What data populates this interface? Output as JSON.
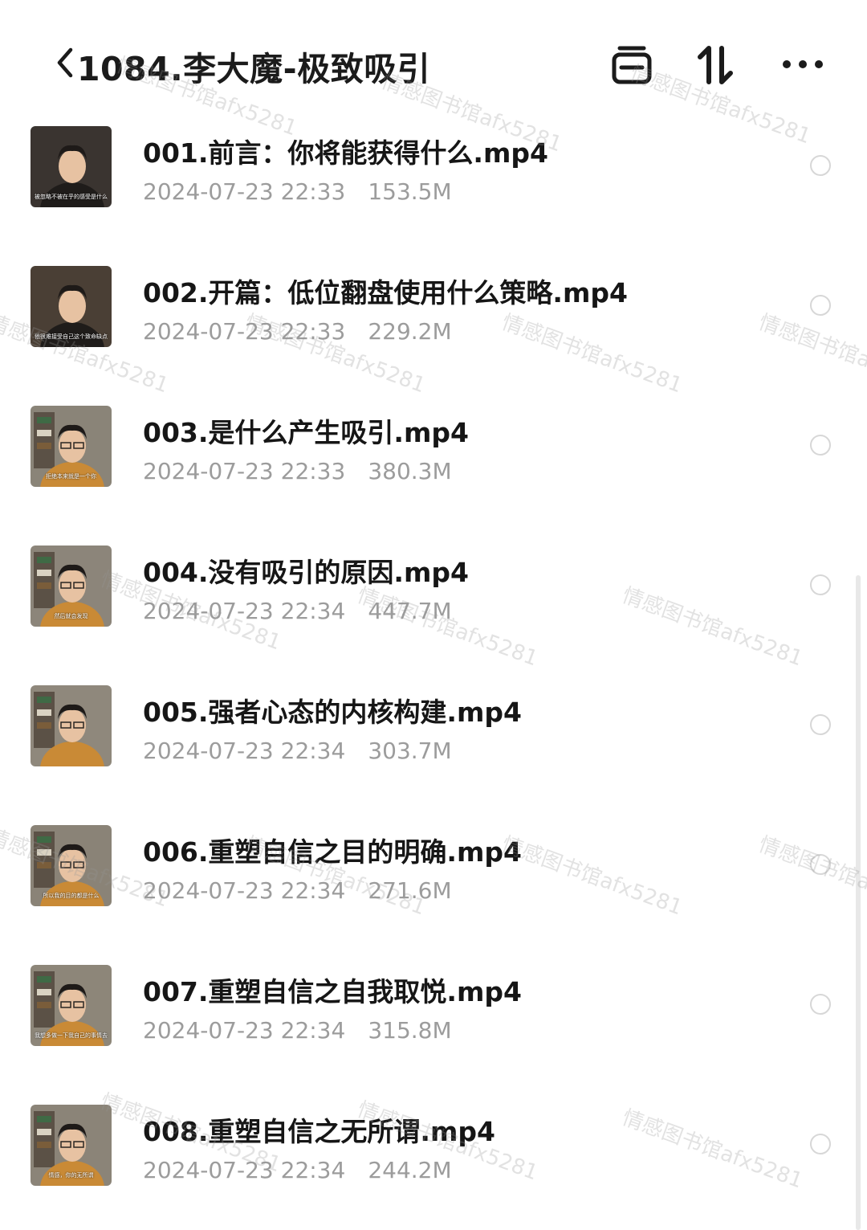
{
  "header": {
    "title": "1084.李大魔-极致吸引"
  },
  "files": [
    {
      "name": "001.前言：你将能获得什么.mp4",
      "date": "2024-07-23 22:33",
      "size": "153.5M",
      "caption": "被忽略不被在乎的感受是什么"
    },
    {
      "name": "002.开篇：低位翻盘使用什么策略.mp4",
      "date": "2024-07-23 22:33",
      "size": "229.2M",
      "caption": "他很难接受自己这个致命缺点"
    },
    {
      "name": "003.是什么产生吸引.mp4",
      "date": "2024-07-23 22:33",
      "size": "380.3M",
      "caption": "拒绝本来就是一个你"
    },
    {
      "name": "004.没有吸引的原因.mp4",
      "date": "2024-07-23 22:34",
      "size": "447.7M",
      "caption": "然后就会发现"
    },
    {
      "name": "005.强者心态的内核构建.mp4",
      "date": "2024-07-23 22:34",
      "size": "303.7M",
      "caption": ""
    },
    {
      "name": "006.重塑自信之目的明确.mp4",
      "date": "2024-07-23 22:34",
      "size": "271.6M",
      "caption": "所以我的目的都是什么"
    },
    {
      "name": "007.重塑自信之自我取悦.mp4",
      "date": "2024-07-23 22:34",
      "size": "315.8M",
      "caption": "我想多做一下我自己的事情去"
    },
    {
      "name": "008.重塑自信之无所谓.mp4",
      "date": "2024-07-23 22:34",
      "size": "244.2M",
      "caption": "情感，你的无所谓"
    }
  ],
  "watermark": "情感图书馆afx5281",
  "colors": {
    "title": "#1b1b1b",
    "meta": "#9c9c9c",
    "radio": "#d7d7d7"
  }
}
